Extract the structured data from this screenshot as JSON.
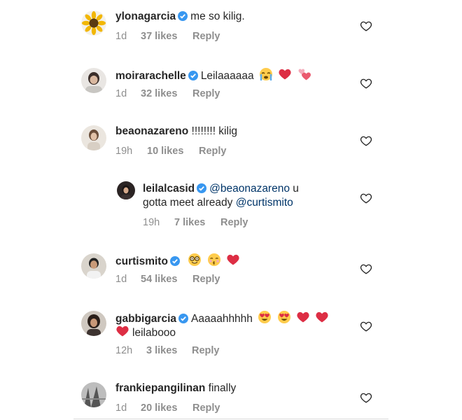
{
  "comments": [
    {
      "username": "ylonagarcia",
      "verified": true,
      "text": "me so kilig.",
      "emojis": [],
      "time": "1d",
      "likes": "37 likes",
      "reply": "Reply"
    },
    {
      "username": "moirarachelle",
      "verified": true,
      "text": "Leilaaaaaa",
      "emojis": [
        "crying-face-emoji",
        "red-heart-emoji",
        "two-hearts-emoji"
      ],
      "time": "1d",
      "likes": "32 likes",
      "reply": "Reply"
    },
    {
      "username": "beaonazareno",
      "verified": false,
      "text": "!!!!!!!! kilig",
      "emojis": [],
      "time": "19h",
      "likes": "10 likes",
      "reply": "Reply"
    },
    {
      "username": "leilalcasid",
      "verified": true,
      "mention1": "@beaonazareno",
      "text1": " u",
      "text2": "gotta meet already ",
      "mention2": "@curtismito",
      "time": "19h",
      "likes": "7 likes",
      "reply": "Reply"
    },
    {
      "username": "curtismito",
      "verified": true,
      "text": "",
      "emojis": [
        "nerd-face-emoji",
        "kissing-face-emoji",
        "red-heart-emoji"
      ],
      "time": "1d",
      "likes": "54 likes",
      "reply": "Reply"
    },
    {
      "username": "gabbigarcia",
      "verified": true,
      "text": "Aaaaahhhhh",
      "text2": "leilabooo",
      "emojis": [
        "heart-eyes-emoji",
        "heart-eyes-emoji",
        "red-heart-emoji",
        "red-heart-emoji"
      ],
      "time": "12h",
      "likes": "3 likes",
      "reply": "Reply"
    },
    {
      "username": "frankiepangilinan",
      "verified": false,
      "text": "finally",
      "emojis": [],
      "time": "1d",
      "likes": "20 likes",
      "reply": "Reply"
    }
  ],
  "colors": {
    "text": "#262626",
    "meta": "#8e8e8e",
    "mention": "#003569",
    "verified": "#3897f0",
    "heart_emoji": "#e0245e"
  }
}
